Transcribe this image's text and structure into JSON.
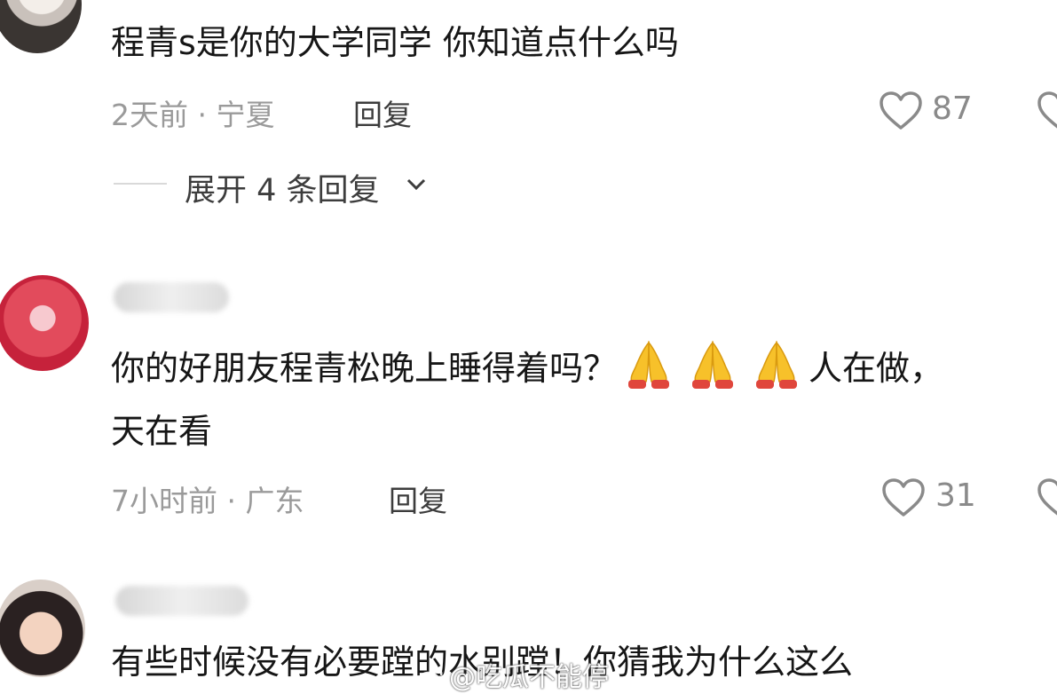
{
  "comments": [
    {
      "text": "程青s是你的大学同学 你知道点什么吗",
      "meta": "2天前 · 宁夏",
      "reply_label": "回复",
      "likes": "87",
      "expand_label": "展开 4 条回复"
    },
    {
      "text_part1": "你的好朋友程青松晚上睡得着吗？",
      "emoji": "folded-hands-icon",
      "text_part2": "人在做，",
      "text_line2": "天在看",
      "meta": "7小时前 · 广东",
      "reply_label": "回复",
      "likes": "31"
    },
    {
      "text": "有些时候没有必要蹚的水别蹚！你猜我为什么这么"
    }
  ],
  "watermark": "@吃瓜不能停",
  "colors": {
    "meta": "#9a9a9a",
    "text": "#161616",
    "heart_outline": "#8a8a8a",
    "emoji_yellow": "#f7c12a",
    "emoji_cuff": "#e0463c"
  }
}
